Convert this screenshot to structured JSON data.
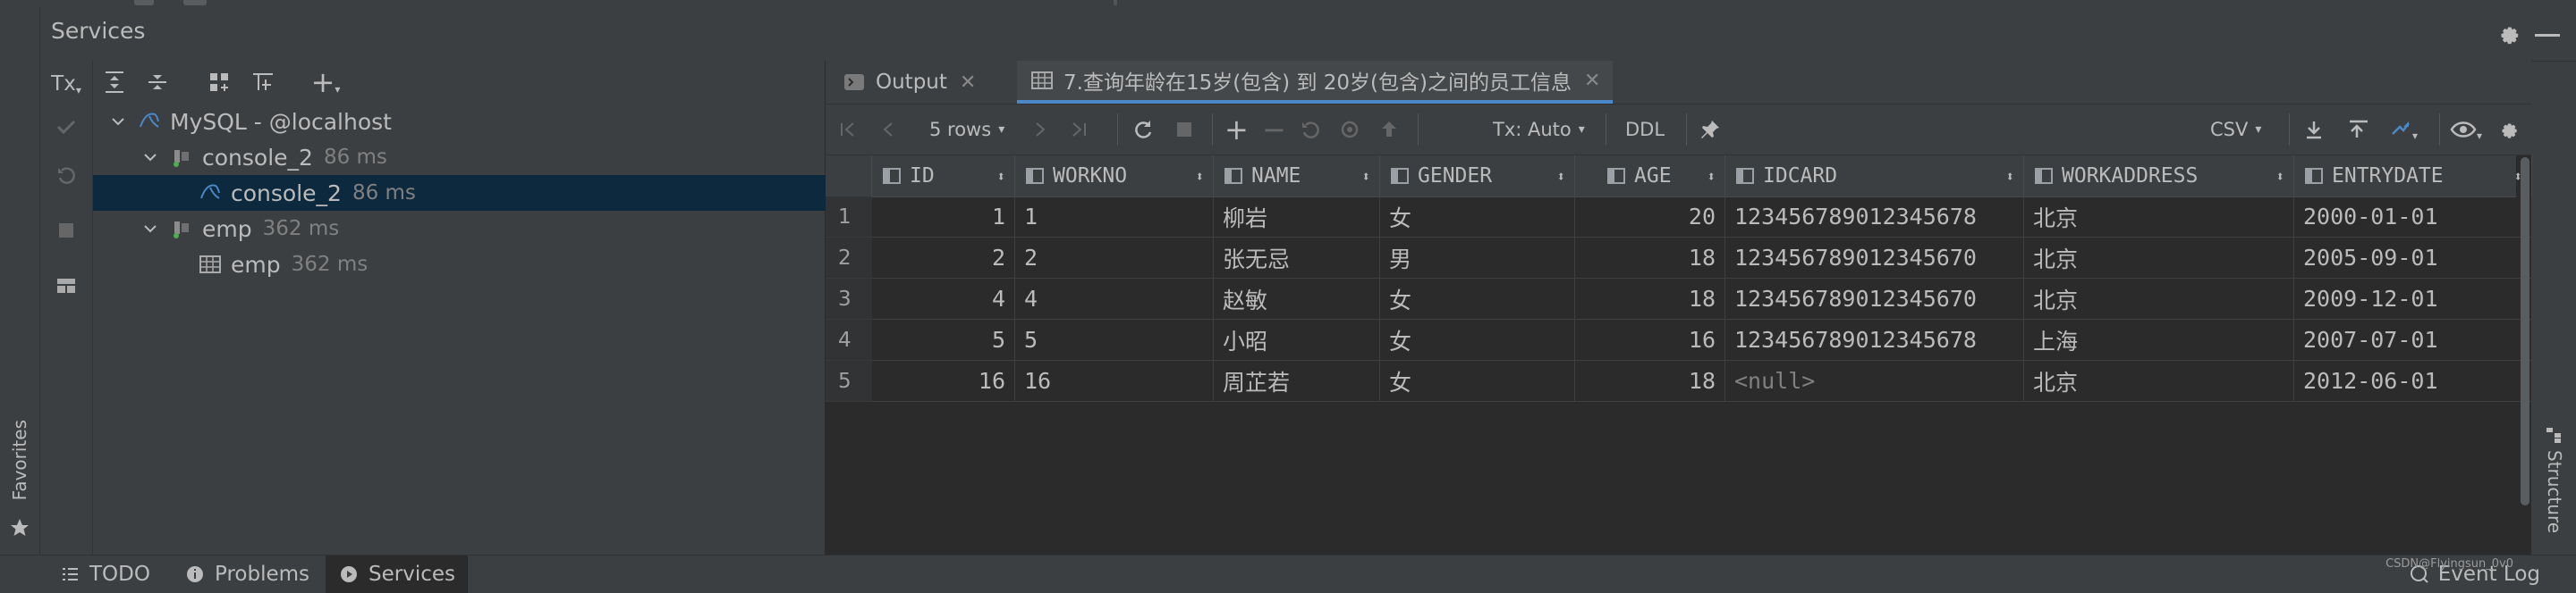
{
  "services": {
    "title": "Services",
    "toolbar": {
      "tx_label": "Tx"
    }
  },
  "side": {
    "favorites_label": "Favorites",
    "structure_label": "Structure"
  },
  "tree": {
    "items": [
      {
        "label": "MySQL - @localhost",
        "meta": ""
      },
      {
        "label": "console_2",
        "meta": "86 ms"
      },
      {
        "label": "console_2",
        "meta": "86 ms"
      },
      {
        "label": "emp",
        "meta": "362 ms"
      },
      {
        "label": "emp",
        "meta": "362 ms"
      }
    ]
  },
  "tabs": [
    {
      "label": "Output"
    },
    {
      "label": "7.查询年龄在15岁(包含) 到 20岁(包含)之间的员工信息"
    }
  ],
  "gridtoolbar": {
    "rows_label": "5 rows",
    "tx_label": "Tx: Auto",
    "ddl_label": "DDL",
    "export_format": "CSV"
  },
  "grid": {
    "columns": [
      "ID",
      "WORKNO",
      "NAME",
      "GENDER",
      "AGE",
      "IDCARD",
      "WORKADDRESS",
      "ENTRYDATE"
    ],
    "rows": [
      {
        "num": "1",
        "id": "1",
        "workno": "1",
        "name": "柳岩",
        "gender": "女",
        "age": "20",
        "idcard": "123456789012345678",
        "workaddress": "北京",
        "entrydate": "2000-01-01"
      },
      {
        "num": "2",
        "id": "2",
        "workno": "2",
        "name": "张无忌",
        "gender": "男",
        "age": "18",
        "idcard": "123456789012345670",
        "workaddress": "北京",
        "entrydate": "2005-09-01"
      },
      {
        "num": "3",
        "id": "4",
        "workno": "4",
        "name": "赵敏",
        "gender": "女",
        "age": "18",
        "idcard": "123456789012345670",
        "workaddress": "北京",
        "entrydate": "2009-12-01"
      },
      {
        "num": "4",
        "id": "5",
        "workno": "5",
        "name": "小昭",
        "gender": "女",
        "age": "16",
        "idcard": "123456789012345678",
        "workaddress": "上海",
        "entrydate": "2007-07-01"
      },
      {
        "num": "5",
        "id": "16",
        "workno": "16",
        "name": "周芷若",
        "gender": "女",
        "age": "18",
        "idcard": "<null>",
        "workaddress": "北京",
        "entrydate": "2012-06-01"
      }
    ]
  },
  "statusbar": {
    "todo": "TODO",
    "problems": "Problems",
    "services": "Services",
    "event_log": "Event Log",
    "watermark": "CSDN@Flyingsun_0v0"
  }
}
